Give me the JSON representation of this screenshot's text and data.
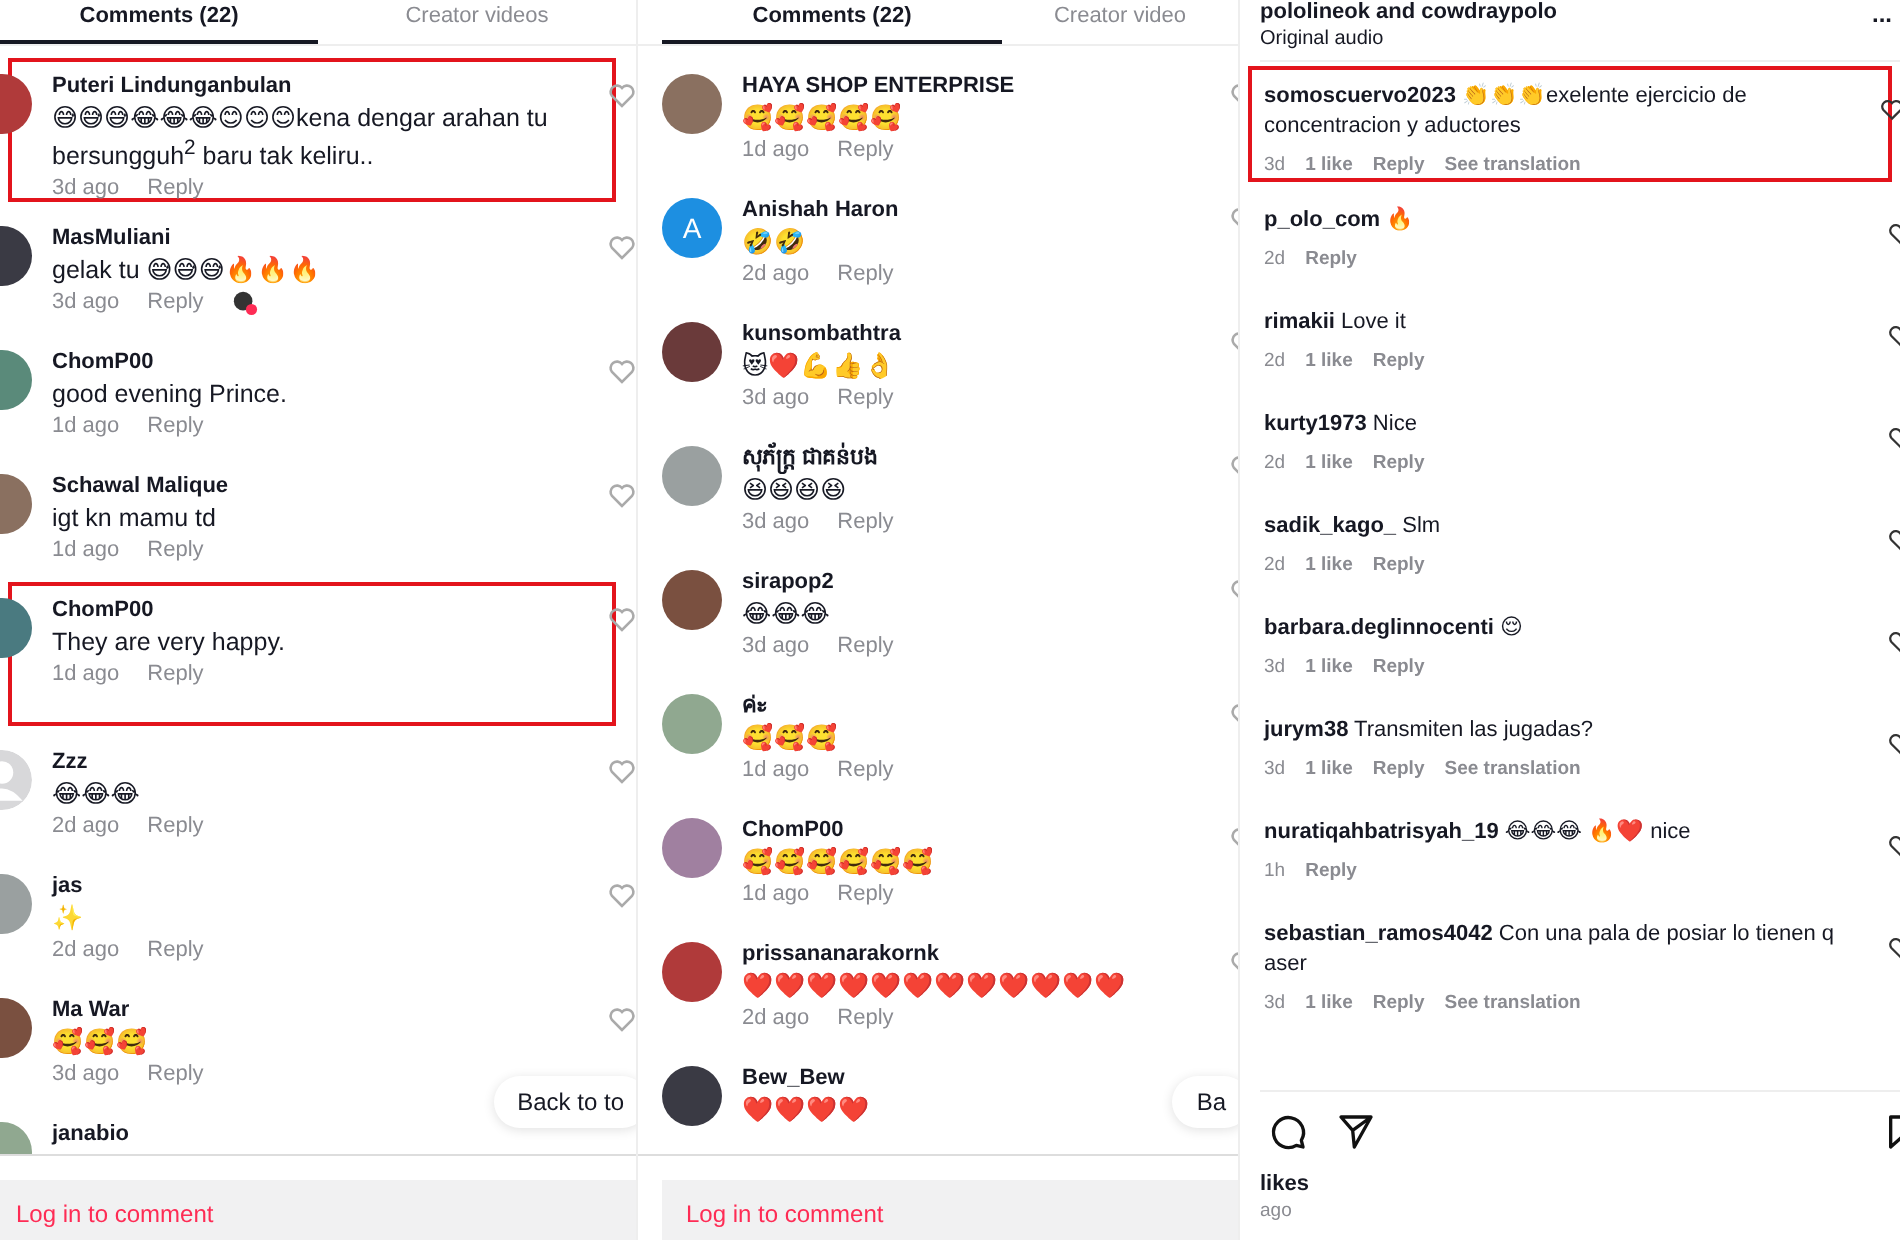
{
  "left_panel": {
    "tabs": [
      {
        "label": "Comments (22)",
        "selected": true
      },
      {
        "label": "Creator videos",
        "selected": false
      }
    ],
    "comments": [
      {
        "user": "Puteri Lindunganbulan",
        "avatar": {
          "kind": "photo"
        },
        "text": "😅😅😅😂😂😂😊😊😊kena dengar arahan tu bersungguh$^{2}$ baru tak keliru..",
        "time": "3d ago",
        "reply": "Reply",
        "highlighted": true
      },
      {
        "user": "MasMuliani",
        "avatar": {
          "kind": "photo"
        },
        "text": "gelak tu 😅😅😅🔥🔥🔥",
        "time": "3d ago",
        "reply": "Reply",
        "highlighted": false,
        "creator_liked": true
      },
      {
        "user": "ChomP00",
        "avatar": {
          "kind": "photo"
        },
        "text": "good evening Prince.",
        "time": "1d ago",
        "reply": "Reply",
        "highlighted": false
      },
      {
        "user": "Schawal Malique",
        "avatar": {
          "kind": "photo"
        },
        "text": "igt kn mamu td",
        "time": "1d ago",
        "reply": "Reply",
        "highlighted": false
      },
      {
        "user": "ChomP00",
        "avatar": {
          "kind": "photo"
        },
        "text": "They are very happy.",
        "time": "1d ago",
        "reply": "Reply",
        "highlighted": true
      },
      {
        "user": "Zzz",
        "avatar": {
          "kind": "default"
        },
        "text": "😂😂😂",
        "time": "2d ago",
        "reply": "Reply",
        "highlighted": false
      },
      {
        "user": "jas",
        "avatar": {
          "kind": "photo"
        },
        "text": "✨",
        "time": "2d ago",
        "reply": "Reply",
        "highlighted": false
      },
      {
        "user": "Ma War",
        "avatar": {
          "kind": "photo"
        },
        "text": "🥰🥰🥰",
        "time": "3d ago",
        "reply": "Reply",
        "highlighted": false
      },
      {
        "user": "janabio",
        "avatar": {
          "kind": "photo"
        },
        "highlighted": false
      }
    ],
    "back_to_top": "Back to to",
    "login": "Log in to comment"
  },
  "middle_panel": {
    "tabs": [
      {
        "label": "Comments (22)",
        "selected": true
      },
      {
        "label": "Creator video",
        "selected": false
      }
    ],
    "comments": [
      {
        "user": "HAYA SHOP ENTERPRISE",
        "avatar": {
          "kind": "photo"
        },
        "text": "🥰🥰🥰🥰🥰",
        "time": "1d ago",
        "reply": "Reply"
      },
      {
        "user": "Anishah Haron",
        "avatar": {
          "kind": "letter",
          "letter": "A"
        },
        "text": "🤣🤣",
        "time": "2d ago",
        "reply": "Reply"
      },
      {
        "user": "kunsombathtra",
        "avatar": {
          "kind": "photo"
        },
        "text": "😻❤️💪👍👌",
        "time": "3d ago",
        "reply": "Reply"
      },
      {
        "user": "សុភ័ក្ត្រ ជាគន់បង",
        "avatar": {
          "kind": "photo"
        },
        "text": "😆😆😆😆",
        "time": "3d ago",
        "reply": "Reply"
      },
      {
        "user": "sirapop2",
        "avatar": {
          "kind": "photo"
        },
        "text": "😂😂😂",
        "time": "3d ago",
        "reply": "Reply"
      },
      {
        "user": "ค่ะ",
        "avatar": {
          "kind": "photo"
        },
        "text": "🥰🥰🥰",
        "time": "1d ago",
        "reply": "Reply"
      },
      {
        "user": "ChomP00",
        "avatar": {
          "kind": "photo"
        },
        "text": "🥰🥰🥰🥰🥰🥰",
        "time": "1d ago",
        "reply": "Reply"
      },
      {
        "user": "prissananarakornk",
        "avatar": {
          "kind": "photo"
        },
        "text": "❤️❤️❤️❤️❤️❤️❤️❤️❤️❤️❤️❤️",
        "time": "2d ago",
        "reply": "Reply"
      },
      {
        "user": "Bew_Bew",
        "avatar": {
          "kind": "photo"
        },
        "text": "❤️❤️❤️❤️"
      }
    ],
    "back_to_top": "Ba",
    "login": "Log in to comment"
  },
  "right_panel": {
    "header": {
      "title": "pololineok and cowdraypolo",
      "subtitle": "Original audio",
      "menu": "..."
    },
    "comments": [
      {
        "user": "somoscuervo2023",
        "text": "👏👏👏exelente ejercicio de concentracion y aductores",
        "time": "3d",
        "likes": "1 like",
        "reply": "Reply",
        "translation": "See translation",
        "highlighted": true
      },
      {
        "user": "p_olo_com",
        "text": "🔥",
        "time": "2d",
        "reply": "Reply",
        "highlighted": false
      },
      {
        "user": "rimakii",
        "text": "Love it",
        "time": "2d",
        "likes": "1 like",
        "reply": "Reply",
        "highlighted": false
      },
      {
        "user": "kurty1973",
        "text": "Nice",
        "time": "2d",
        "likes": "1 like",
        "reply": "Reply",
        "highlighted": false
      },
      {
        "user": "sadik_kago_",
        "text": "Slm",
        "time": "2d",
        "likes": "1 like",
        "reply": "Reply",
        "highlighted": false
      },
      {
        "user": "barbara.deglinnocenti",
        "text": "😌",
        "time": "3d",
        "likes": "1 like",
        "reply": "Reply",
        "highlighted": false
      },
      {
        "user": "jurym38",
        "text": "Transmiten las jugadas?",
        "time": "3d",
        "likes": "1 like",
        "reply": "Reply",
        "translation": "See translation",
        "highlighted": false
      },
      {
        "user": "nuratiqahbatrisyah_19",
        "text": "😂😂😂 🔥❤️ nice",
        "time": "1h",
        "reply": "Reply",
        "highlighted": false
      },
      {
        "user": "sebastian_ramos4042",
        "text": "Con una pala de posiar lo tienen q aser",
        "time": "3d",
        "likes": "1 like",
        "reply": "Reply",
        "translation": "See translation",
        "highlighted": false
      }
    ],
    "likes": "likes",
    "ago": "ago"
  }
}
